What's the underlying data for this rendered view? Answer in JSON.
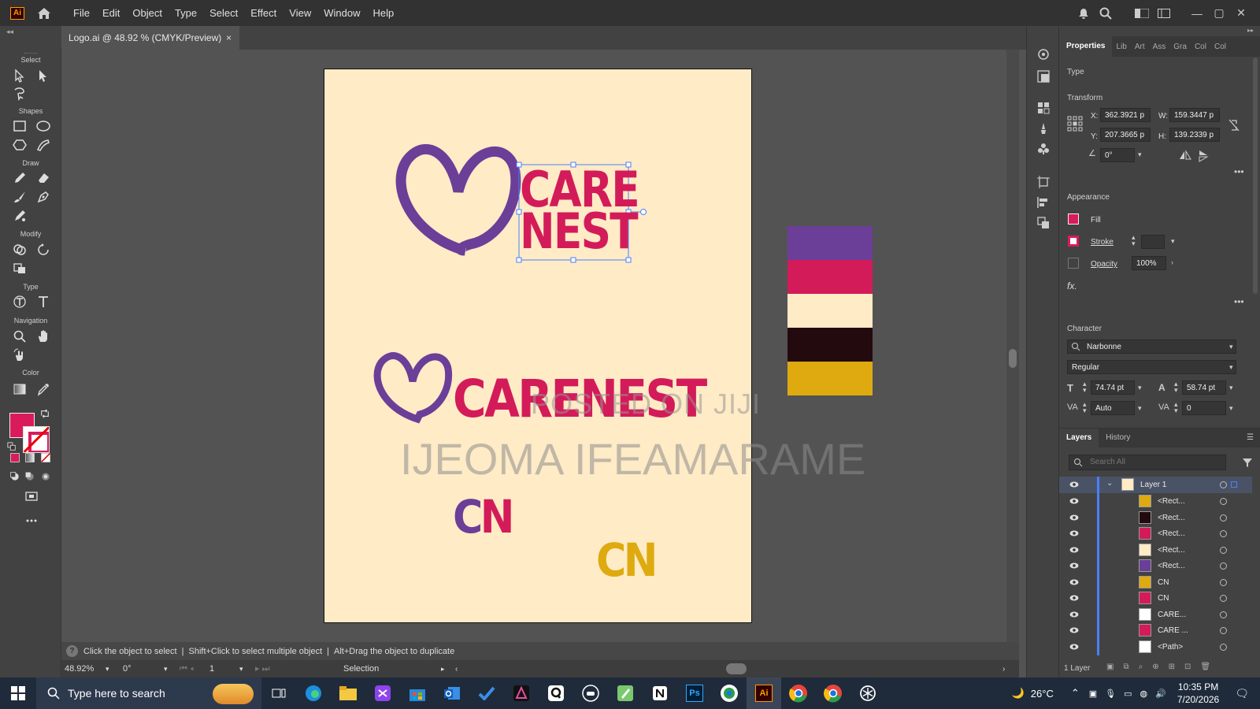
{
  "app": {
    "logo_text": "Ai",
    "menus": [
      "File",
      "Edit",
      "Object",
      "Type",
      "Select",
      "Effect",
      "View",
      "Window",
      "Help"
    ]
  },
  "document": {
    "tab_title": "Logo.ai @ 48.92 % (CMYK/Preview)",
    "close_glyph": "×"
  },
  "toolbar": {
    "sections": {
      "select": "Select",
      "shapes": "Shapes",
      "draw": "Draw",
      "modify": "Modify",
      "type": "Type",
      "navigation": "Navigation",
      "color": "Color"
    },
    "fill_color": "#d91b5c"
  },
  "artwork": {
    "logo_line1": "CARE",
    "logo_line2": "NEST",
    "wordmark": "CARENEST",
    "monogram": "CN",
    "watermark_small": "POSTED ON JIJI",
    "watermark_large": "IJEOMA IFEAMARAME",
    "colors": {
      "purple": "#6b3e98",
      "magenta": "#d31b5a",
      "cream": "#ffebc6",
      "dark": "#230a0f",
      "gold": "#deaa0f"
    }
  },
  "palette": [
    "#6b3e98",
    "#d31b5a",
    "#ffebc6",
    "#230a0f",
    "#deaa0f"
  ],
  "status": {
    "hint1": "Click the object to select",
    "hint2": "Shift+Click to select multiple object",
    "hint3": "Alt+Drag the object to duplicate",
    "zoom": "48.92%",
    "rotation": "0°",
    "artboard": "1",
    "mode": "Selection"
  },
  "properties": {
    "tabs": [
      "Properties",
      "Lib",
      "Art",
      "Ass",
      "Gra",
      "Col",
      "Col"
    ],
    "type_title": "Type",
    "transform_title": "Transform",
    "x_label": "X:",
    "x_value": "362.3921 p",
    "y_label": "Y:",
    "y_value": "207.3665 p",
    "w_label": "W:",
    "w_value": "159.3447 p",
    "h_label": "H:",
    "h_value": "139.2339 p",
    "angle_value": "0°",
    "appearance_title": "Appearance",
    "fill_label": "Fill",
    "stroke_label": "Stroke",
    "opacity_label": "Opacity",
    "opacity_value": "100%",
    "fx_label": "fx.",
    "character_title": "Character",
    "font_family": "Narbonne",
    "font_style": "Regular",
    "font_size": "74.74 pt",
    "leading": "58.74 pt",
    "kerning": "Auto",
    "tracking": "0"
  },
  "layers": {
    "tabs": [
      "Layers",
      "History"
    ],
    "search_placeholder": "Search All",
    "layer_name": "Layer 1",
    "items": [
      {
        "name": "<Rect...",
        "thumb": "#deaa0f"
      },
      {
        "name": "<Rect...",
        "thumb": "#230a0f"
      },
      {
        "name": "<Rect...",
        "thumb": "#d31b5a"
      },
      {
        "name": "<Rect...",
        "thumb": "#ffebc6"
      },
      {
        "name": "<Rect...",
        "thumb": "#6b3e98"
      },
      {
        "name": "CN",
        "thumb": "#deaa0f"
      },
      {
        "name": "CN",
        "thumb": "#d31b5a"
      },
      {
        "name": "CARE...",
        "thumb": "#ffffff"
      },
      {
        "name": "CARE ...",
        "thumb": "#d31b5a"
      },
      {
        "name": "<Path>",
        "thumb": "#ffffff"
      }
    ],
    "footer": "1 Layer"
  },
  "taskbar": {
    "search_placeholder": "Type here to search",
    "temperature": "26°C",
    "time": "10:35 PM",
    "date": "7/20/2026",
    "apps": [
      "Ps",
      "Ai"
    ]
  }
}
